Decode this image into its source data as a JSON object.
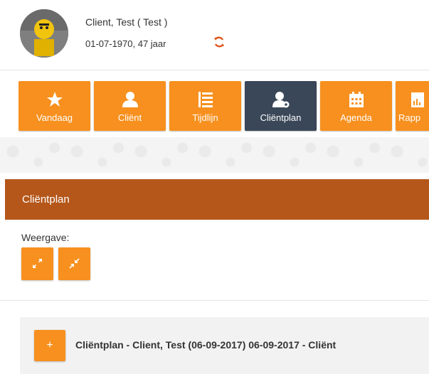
{
  "client": {
    "name": "Client, Test ( Test )",
    "dob_age": "01-07-1970, 47 jaar",
    "refresh_icon": "refresh-icon"
  },
  "toolbar": {
    "tiles": [
      {
        "label": "Vandaag",
        "icon": "star-icon",
        "active": false
      },
      {
        "label": "Cliënt",
        "icon": "user-icon",
        "active": false
      },
      {
        "label": "Tijdlijn",
        "icon": "list-icon",
        "active": false
      },
      {
        "label": "Cliëntplan",
        "icon": "user-plan-icon",
        "active": true
      },
      {
        "label": "Agenda",
        "icon": "calendar-icon",
        "active": false
      },
      {
        "label": "Rapp",
        "icon": "report-icon",
        "active": false
      }
    ]
  },
  "section": {
    "title": "Cliëntplan"
  },
  "view": {
    "label": "Weergave:",
    "expand_icon": "expand-icon",
    "collapse_icon": "collapse-icon"
  },
  "plan": {
    "add_label": "+",
    "title": "Cliëntplan - Client, Test (06-09-2017) 06-09-2017 - Cliënt"
  },
  "colors": {
    "orange": "#f7901e",
    "active_tile": "#3a4758",
    "section_header": "#b5571a",
    "plan_row_bg": "#f2f2f2"
  }
}
